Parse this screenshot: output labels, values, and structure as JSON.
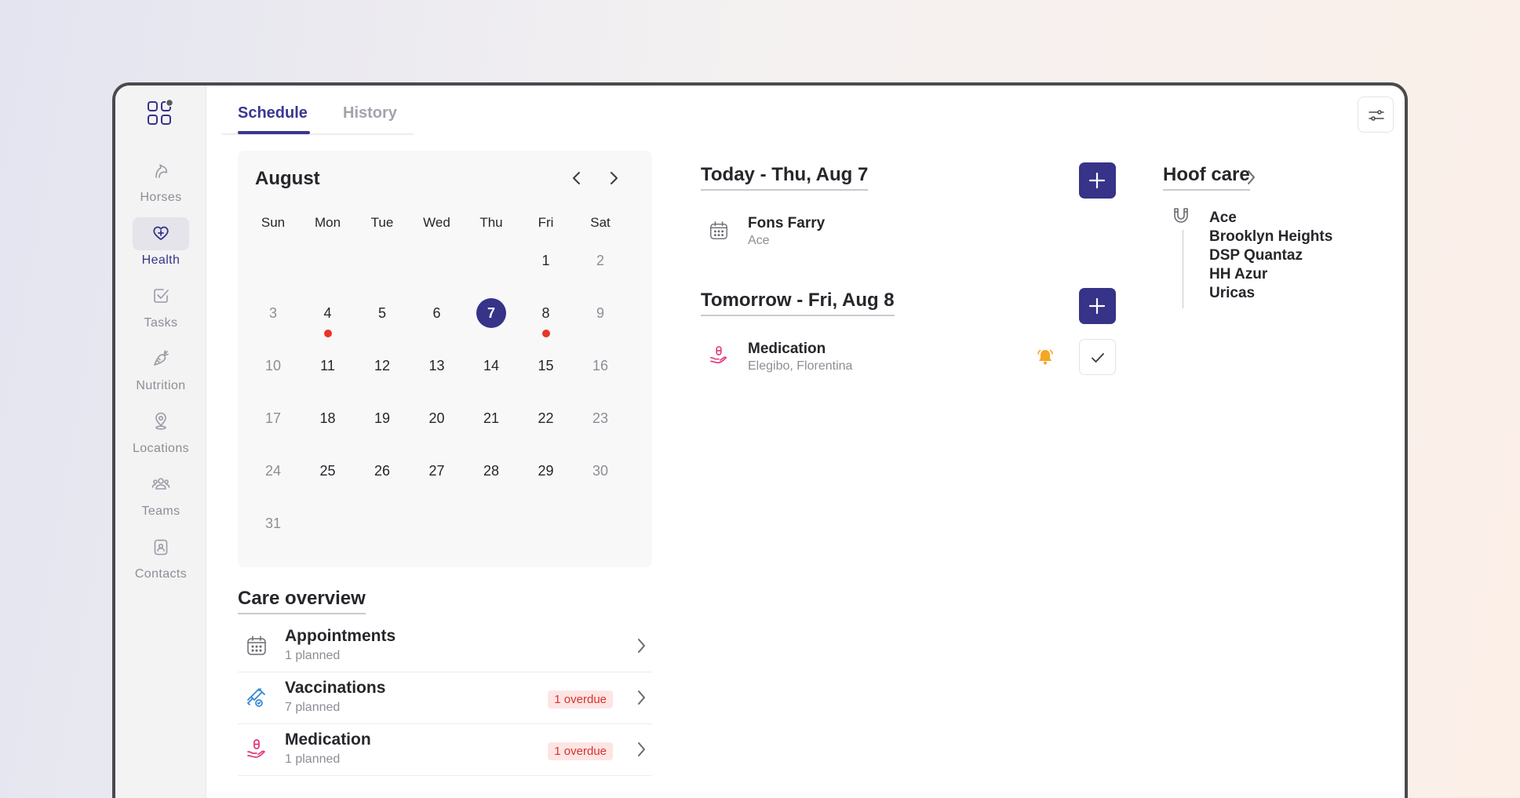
{
  "sidebar": {
    "items": [
      {
        "label": "Horses"
      },
      {
        "label": "Health"
      },
      {
        "label": "Tasks"
      },
      {
        "label": "Nutrition"
      },
      {
        "label": "Locations"
      },
      {
        "label": "Teams"
      },
      {
        "label": "Contacts"
      }
    ]
  },
  "tabs": [
    {
      "label": "Schedule"
    },
    {
      "label": "History"
    }
  ],
  "calendar": {
    "month": "August",
    "weekdays": [
      "Sun",
      "Mon",
      "Tue",
      "Wed",
      "Thu",
      "Fri",
      "Sat"
    ],
    "days": [
      "1",
      "2",
      "3",
      "4",
      "5",
      "6",
      "7",
      "8",
      "9",
      "10",
      "11",
      "12",
      "13",
      "14",
      "15",
      "16",
      "17",
      "18",
      "19",
      "20",
      "21",
      "22",
      "23",
      "24",
      "25",
      "26",
      "27",
      "28",
      "29",
      "30",
      "31"
    ],
    "selected_day": "7",
    "event_days": [
      "4",
      "8"
    ]
  },
  "care_overview": {
    "title": "Care overview",
    "items": [
      {
        "title": "Appointments",
        "subtitle": "1 planned",
        "badge": ""
      },
      {
        "title": "Vaccinations",
        "subtitle": "7 planned",
        "badge": "1 overdue"
      },
      {
        "title": "Medication",
        "subtitle": "1 planned",
        "badge": "1 overdue"
      }
    ]
  },
  "today": {
    "title": "Today - Thu, Aug 7",
    "events": [
      {
        "title": "Fons Farry",
        "subtitle": "Ace"
      }
    ]
  },
  "tomorrow": {
    "title": "Tomorrow - Fri, Aug 8",
    "events": [
      {
        "title": "Medication",
        "subtitle": "Elegibo, Florentina"
      }
    ]
  },
  "hoof_care": {
    "title": "Hoof care",
    "horses": [
      "Ace",
      "Brooklyn Heights",
      "DSP Quantaz",
      "HH Azur",
      "Uricas"
    ]
  },
  "colors": {
    "accent": "#363388",
    "event_dot": "#e8352a",
    "overdue": "#d8322b",
    "bell": "#f5a623"
  }
}
